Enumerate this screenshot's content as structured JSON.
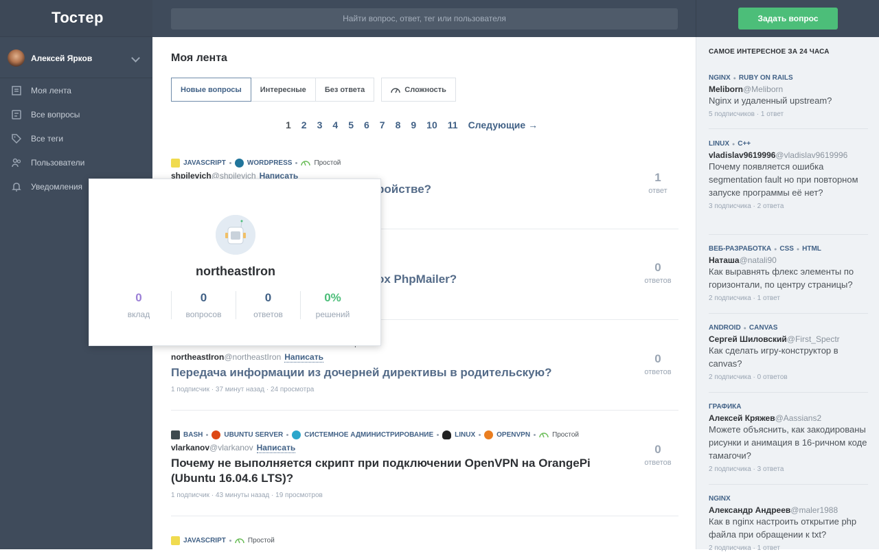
{
  "header": {
    "logo": "Тостер",
    "search_placeholder": "Найти вопрос, ответ, тег или пользователя",
    "ask_button": "Задать вопрос"
  },
  "sidebar": {
    "user": "Алексей Ярков",
    "items": [
      {
        "label": "Моя лента",
        "icon": "feed-icon"
      },
      {
        "label": "Все вопросы",
        "icon": "questions-icon"
      },
      {
        "label": "Все теги",
        "icon": "tag-icon"
      },
      {
        "label": "Пользователи",
        "icon": "users-icon"
      },
      {
        "label": "Уведомления",
        "icon": "bell-icon"
      }
    ]
  },
  "main": {
    "title": "Моя лента",
    "tabs": [
      "Новые вопросы",
      "Интересные",
      "Без ответа",
      "Сложность"
    ],
    "pagination": [
      "1",
      "2",
      "3",
      "4",
      "5",
      "6",
      "7",
      "8",
      "9",
      "10",
      "11"
    ],
    "next": "Следующие →",
    "questions": [
      {
        "tags": [
          "JAVASCRIPT",
          "WORDPRESS"
        ],
        "difficulty": "Простой",
        "author": "shpilevich",
        "nick": "@shpilevich",
        "write": "Написать",
        "title": "ройстве?",
        "answers": "1",
        "answers_label": "ответ",
        "meta": ""
      },
      {
        "tags": [],
        "difficulty": "",
        "author": "",
        "nick": "",
        "write": "",
        "title": "ox PhpMailer?",
        "answers": "0",
        "answers_label": "ответов",
        "meta": ""
      },
      {
        "tags": [],
        "difficulty": "Простой",
        "author": "northeastIron",
        "nick": "@northeastIron",
        "write": "Написать",
        "title": "Передача информации из дочерней директивы в родительскую?",
        "answers": "0",
        "answers_label": "ответов",
        "meta": "1 подписчик · 37 минут назад · 24 просмотра"
      },
      {
        "tags": [
          "BASH",
          "UBUNTU SERVER",
          "СИСТЕМНОЕ АДМИНИСТРИРОВАНИЕ",
          "LINUX",
          "OPENVPN"
        ],
        "difficulty": "Простой",
        "author": "vlarkanov",
        "nick": "@vlarkanov",
        "write": "Написать",
        "title": "Почему не выполняется скрипт при подключении OpenVPN на OrangePi (Ubuntu 16.04.6 LTS)?",
        "answers": "0",
        "answers_label": "ответов",
        "meta": "1 подписчик · 43 минуты назад · 19 просмотров"
      },
      {
        "tags": [
          "JAVASCRIPT"
        ],
        "difficulty": "Простой",
        "author": "",
        "nick": "",
        "write": "",
        "title": "",
        "answers": "",
        "answers_label": "",
        "meta": ""
      }
    ]
  },
  "right": {
    "title": "САМОЕ ИНТЕРЕСНОЕ ЗА 24 ЧАСА",
    "items": [
      {
        "tags": [
          "NGINX",
          "RUBY ON RAILS"
        ],
        "user": "Meliborn",
        "nick": "@Meliborn",
        "question": "Nginx и удаленный upstream?",
        "meta": "5 подписчиков · 1 ответ"
      },
      {
        "tags": [
          "LINUX",
          "C++"
        ],
        "user": "vladislav9619996",
        "nick": "@vladislav9619996",
        "question": "Почему появляется ошибка segmentation fault но при повторном запуске программы её нет?",
        "meta": "3 подписчика · 2 ответа"
      },
      {
        "tags": [
          "ВЕБ-РАЗРАБОТКА",
          "CSS",
          "HTML"
        ],
        "user": "Наташа",
        "nick": "@natali90",
        "question": "Как выравнять флекс элементы по горизонтали, по центру страницы?",
        "meta": "2 подписчика · 1 ответ"
      },
      {
        "tags": [
          "ANDROID",
          "CANVAS"
        ],
        "user": "Сергей Шиловский",
        "nick": "@First_Spectr",
        "question": "Как сделать игру-конструктор в canvas?",
        "meta": "2 подписчика · 0 ответов"
      },
      {
        "tags": [
          "ГРАФИКА"
        ],
        "user": "Алексей Кряжев",
        "nick": "@Aassians2",
        "question": "Можете объяснить, как закодированы рисунки и анимация в 16-ричном коде тамагочи?",
        "meta": "2 подписчика · 3 ответа"
      },
      {
        "tags": [
          "NGINX"
        ],
        "user": "Александр Андреев",
        "nick": "@maler1988",
        "question": "Как в nginx настроить открытие php файла при обращении к txt?",
        "meta": "2 подписчика · 1 ответ"
      }
    ]
  },
  "popup": {
    "name": "northeastIron",
    "stats": [
      {
        "value": "0",
        "label": "вклад",
        "color": "#9b7fd6"
      },
      {
        "value": "0",
        "label": "вопросов",
        "color": "#416186"
      },
      {
        "value": "0",
        "label": "ответов",
        "color": "#416186"
      },
      {
        "value": "0%",
        "label": "решений",
        "color": "#4cbe79"
      }
    ]
  }
}
